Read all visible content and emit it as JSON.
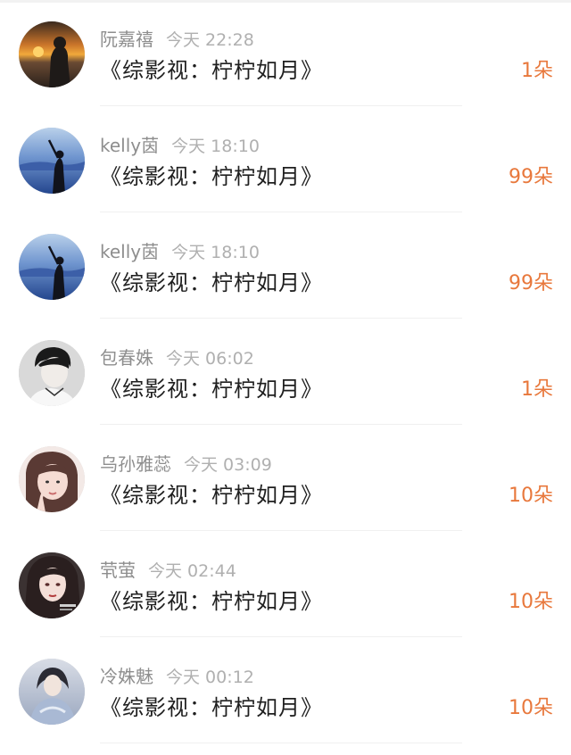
{
  "records": [
    {
      "name": "阮嘉禧",
      "time": "今天 22:28",
      "title": "《综影视：柠柠如月》",
      "gift": "1朵",
      "avatar": "sunset-silhouette-avatar"
    },
    {
      "name": "kelly茵",
      "time": "今天 18:10",
      "title": "《综影视：柠柠如月》",
      "gift": "99朵",
      "avatar": "blue-sea-figure-avatar"
    },
    {
      "name": "kelly茵",
      "time": "今天 18:10",
      "title": "《综影视：柠柠如月》",
      "gift": "99朵",
      "avatar": "blue-sea-figure-avatar"
    },
    {
      "name": "包春姝",
      "time": "今天 06:02",
      "title": "《综影视：柠柠如月》",
      "gift": "1朵",
      "avatar": "monochrome-boy-avatar"
    },
    {
      "name": "乌孙雅蕊",
      "time": "今天 03:09",
      "title": "《综影视：柠柠如月》",
      "gift": "10朵",
      "avatar": "girl-peace-sign-avatar"
    },
    {
      "name": "茕萤",
      "time": "今天 02:44",
      "title": "《综影视：柠柠如月》",
      "gift": "10朵",
      "avatar": "illustrated-girl-avatar"
    },
    {
      "name": "冷姝魅",
      "time": "今天 00:12",
      "title": "《综影视：柠柠如月》",
      "gift": "10朵",
      "avatar": "painted-lady-avatar"
    }
  ],
  "colors": {
    "gift": "#e8783c",
    "name": "#8e8e8e",
    "time": "#b0b0b0",
    "title": "#1f1f1f"
  }
}
